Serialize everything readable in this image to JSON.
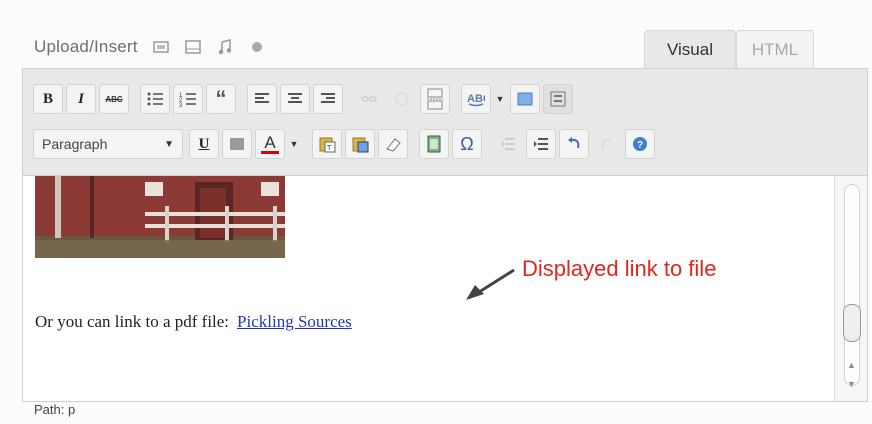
{
  "upload": {
    "label": "Upload/Insert",
    "icons": [
      "image-icon",
      "video-icon",
      "audio-icon",
      "media-icon"
    ]
  },
  "tabs": {
    "visual": "Visual",
    "html": "HTML"
  },
  "toolbar": {
    "row1": [
      "bold-icon",
      "italic-icon",
      "strikethrough-icon",
      "bullet-list-icon",
      "numbered-list-icon",
      "blockquote-icon",
      "align-left-icon",
      "align-center-icon",
      "align-right-icon",
      "link-icon",
      "unlink-icon",
      "more-tag-icon",
      "spellcheck-icon",
      "fullscreen-icon",
      "kitchen-sink-icon"
    ],
    "bold_label": "B",
    "italic_label": "I",
    "strike_label": "ABC",
    "quote_label": "“",
    "format_value": "Paragraph",
    "underline_label": "U",
    "textcolor_label": "A",
    "omega_label": "Ω"
  },
  "content": {
    "paragraph_text": "Or you can link to a pdf file:",
    "link_text": "Pickling Sources"
  },
  "annotation": {
    "text": "Displayed link to file",
    "color": "#e2261c"
  },
  "path": {
    "text": "Path: p"
  }
}
